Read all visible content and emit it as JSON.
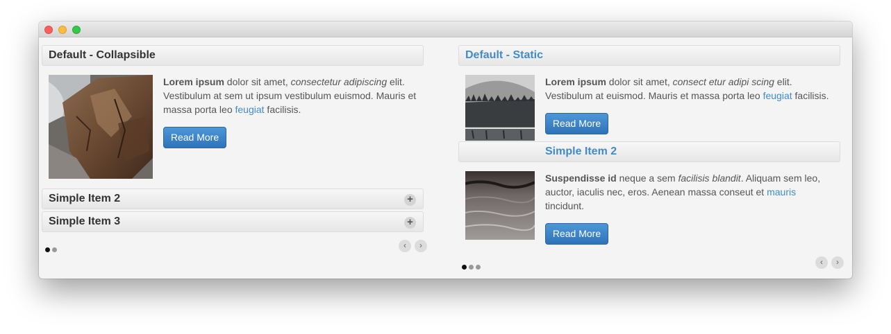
{
  "left": {
    "heading": "Default - Collapsible",
    "item": {
      "strong": "Lorem ipsum",
      "t1": " dolor sit amet, ",
      "em": "consectetur adipiscing",
      "t2": " elit. Vestibulum at sem ut ipsum vestibulum euismod. Mauris et massa porta leo ",
      "link": "feugiat",
      "t3": " facilisis.",
      "button": "Read More"
    },
    "collapsed": [
      {
        "label": "Simple Item 2",
        "icon": "plus-icon"
      },
      {
        "label": "Simple Item 3",
        "icon": "plus-icon"
      }
    ],
    "pager": {
      "pages": 2,
      "active": 1
    },
    "prev": "‹",
    "next": "›"
  },
  "right": {
    "heading": "Default - Static",
    "item1": {
      "strong": "Lorem ipsum",
      "t1": " dolor sit amet, ",
      "em": "consect etur adipi scing",
      "t2": " elit. Vestibulum at euismod. Mauris et massa porta leo ",
      "link": "feugiat",
      "t3": " facilisis.",
      "button": "Read More"
    },
    "item2": {
      "heading": "Simple Item 2",
      "strong": "Suspendisse id",
      "t1": " neque a sem ",
      "em": "facilisis blandit",
      "t2": ". Aliquam sem leo, auctor, iaculis nec, eros. Aenean massa conseut et ",
      "link": "mauris",
      "t3": " tincidunt.",
      "button": "Read More"
    },
    "pager": {
      "pages": 3,
      "active": 1
    },
    "prev": "‹",
    "next": "›"
  },
  "colors": {
    "accent": "#428bca",
    "button": "#3a83c8"
  }
}
